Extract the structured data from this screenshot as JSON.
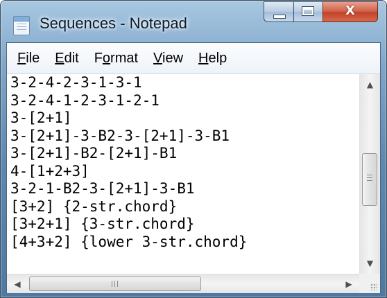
{
  "window": {
    "title": "Sequences - Notepad",
    "app_icon": "notepad-icon",
    "buttons": {
      "minimize_icon": "minimize-icon",
      "maximize_icon": "maximize-icon",
      "close_glyph": "X"
    }
  },
  "menu": [
    {
      "mnemonic": "F",
      "rest": "ile"
    },
    {
      "mnemonic": "E",
      "rest": "dit"
    },
    {
      "pre": "F",
      "mnemonic": "o",
      "rest": "rmat"
    },
    {
      "mnemonic": "V",
      "rest": "iew"
    },
    {
      "mnemonic": "H",
      "rest": "elp"
    }
  ],
  "document": {
    "lines": [
      "3-2-4-2-3-1-3-1",
      "3-2-4-1-2-3-1-2-1",
      "3-[2+1]",
      "3-[2+1]-3-B2-3-[2+1]-3-B1",
      "3-[2+1]-B2-[2+1]-B1",
      "4-[1+2+3]",
      "3-2-1-B2-3-[2+1]-3-B1",
      "[3+2] {2-str.chord}",
      "[3+2+1] {3-str.chord}",
      "[4+3+2] {lower 3-str.chord}"
    ]
  },
  "scrollbars": {
    "up_glyph": "▲",
    "down_glyph": "▼",
    "left_glyph": "◀",
    "right_glyph": "▶",
    "vertical_position": 0.55,
    "horizontal_position": 0.0
  },
  "colors": {
    "titlebar": "#7fa6c9",
    "close_button": "#c0442b"
  }
}
